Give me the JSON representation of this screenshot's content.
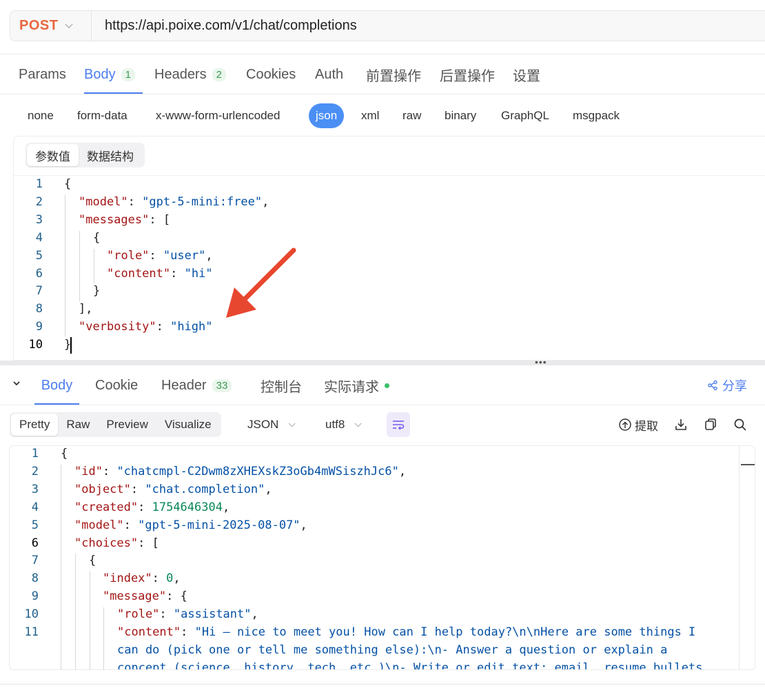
{
  "request": {
    "method": "POST",
    "url": "https://api.poixe.com/v1/chat/completions"
  },
  "request_tabs": [
    {
      "label": "Params"
    },
    {
      "label": "Body",
      "badge": "1",
      "active": true
    },
    {
      "label": "Headers",
      "badge": "2"
    },
    {
      "label": "Cookies"
    },
    {
      "label": "Auth"
    },
    {
      "label": "前置操作"
    },
    {
      "label": "后置操作"
    },
    {
      "label": "设置"
    }
  ],
  "body_types": [
    "none",
    "form-data",
    "x-www-form-urlencoded",
    "json",
    "xml",
    "raw",
    "binary",
    "GraphQL",
    "msgpack"
  ],
  "body_type_selected": "json",
  "editor_tabs": [
    "参数值",
    "数据结构"
  ],
  "request_lines": [
    "1",
    "2",
    "3",
    "4",
    "5",
    "6",
    "7",
    "8",
    "9",
    "10"
  ],
  "request_body": {
    "model_key": "\"model\"",
    "model_val": "\"gpt-5-mini:free\"",
    "messages_key": "\"messages\"",
    "role_key": "\"role\"",
    "role_val": "\"user\"",
    "content_key": "\"content\"",
    "content_val": "\"hi\"",
    "verbosity_key": "\"verbosity\"",
    "verbosity_val": "\"high\""
  },
  "response_tabs": [
    {
      "label": "Body",
      "active": true
    },
    {
      "label": "Cookie"
    },
    {
      "label": "Header",
      "badge": "33"
    },
    {
      "label": "控制台"
    },
    {
      "label": "实际请求",
      "dot": true
    }
  ],
  "share_label": "分享",
  "view_modes": [
    "Pretty",
    "Raw",
    "Preview",
    "Visualize"
  ],
  "format_select": "JSON",
  "encoding_select": "utf8",
  "extract_label": "提取",
  "response_lines": [
    "1",
    "2",
    "3",
    "4",
    "5",
    "6",
    "7",
    "8",
    "9",
    "10",
    "11"
  ],
  "response_body": {
    "id_key": "\"id\"",
    "id_val": "\"chatcmpl-C2Dwm8zXHEXskZ3oGb4mWSiszhJc6\"",
    "object_key": "\"object\"",
    "object_val": "\"chat.completion\"",
    "created_key": "\"created\"",
    "created_val": "1754646304",
    "model_key": "\"model\"",
    "model_val": "\"gpt-5-mini-2025-08-07\"",
    "choices_key": "\"choices\"",
    "index_key": "\"index\"",
    "index_val": "0",
    "message_key": "\"message\"",
    "role_key": "\"role\"",
    "role_val": "\"assistant\"",
    "content_key": "\"content\"",
    "content_line1": "\"Hi — nice to meet you! How can I help today?\\n\\nHere are some things I",
    "content_line2": "can do (pick one or tell me something else):\\n- Answer a question or explain a",
    "content_line3": "concept (science, history, tech, etc.)\\n- Write or edit text: email, resume bullets"
  },
  "colors": {
    "accent": "#4d7df0",
    "method": "#e8663d",
    "json_key": "#a31515",
    "json_string": "#0451a5",
    "json_number": "#098658",
    "annotation_arrow": "#e8472f"
  }
}
